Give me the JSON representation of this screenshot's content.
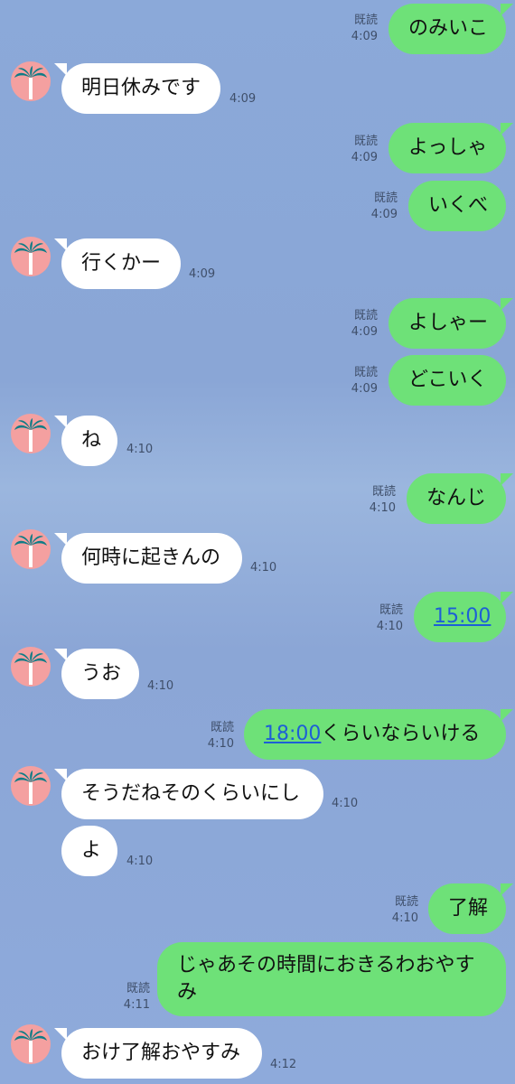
{
  "read_label": "既読",
  "messages": [
    {
      "id": "m1",
      "side": "out",
      "text": "のみいこ",
      "time": "4:09"
    },
    {
      "id": "m2",
      "side": "in",
      "text": "明日休みです",
      "time": "4:09"
    },
    {
      "id": "m3",
      "side": "out",
      "text": "よっしゃ",
      "time": "4:09"
    },
    {
      "id": "m4",
      "side": "out",
      "text": "いくべ",
      "time": "4:09"
    },
    {
      "id": "m5",
      "side": "in",
      "text": "行くかー",
      "time": "4:09"
    },
    {
      "id": "m6",
      "side": "out",
      "text": "よしゃー",
      "time": "4:09"
    },
    {
      "id": "m7",
      "side": "out",
      "text": "どこいく",
      "time": "4:09"
    },
    {
      "id": "m8",
      "side": "in",
      "text": "ね",
      "time": "4:10"
    },
    {
      "id": "m9",
      "side": "out",
      "text": "なんじ",
      "time": "4:10"
    },
    {
      "id": "m10",
      "side": "in",
      "text": "何時に起きんの",
      "time": "4:10"
    },
    {
      "id": "m11",
      "side": "out",
      "link": "15:00",
      "text": "",
      "time": "4:10"
    },
    {
      "id": "m12",
      "side": "in",
      "text": "うお",
      "time": "4:10"
    },
    {
      "id": "m13",
      "side": "out",
      "link": "18:00",
      "text": "くらいならいける",
      "time": "4:10"
    },
    {
      "id": "m14",
      "side": "in",
      "text": "そうだねそのくらいにし",
      "time": "4:10"
    },
    {
      "id": "m15",
      "side": "in",
      "text": "よ",
      "time": "4:10"
    },
    {
      "id": "m16",
      "side": "out",
      "text": "了解",
      "time": "4:10"
    },
    {
      "id": "m17",
      "side": "out",
      "text": "じゃあその時間におきるわおやすみ",
      "time": "4:11"
    },
    {
      "id": "m18",
      "side": "in",
      "text": "おけ了解おやすみ",
      "time": "4:12"
    }
  ],
  "colors": {
    "background": "#8ba9d9",
    "outgoing_bubble": "#6ee178",
    "incoming_bubble": "#ffffff",
    "link": "#1d5fd6",
    "avatar_bg": "#f4a0a0",
    "avatar_palm": "#0e7c86"
  },
  "avatar_icon": "palm-tree-icon"
}
